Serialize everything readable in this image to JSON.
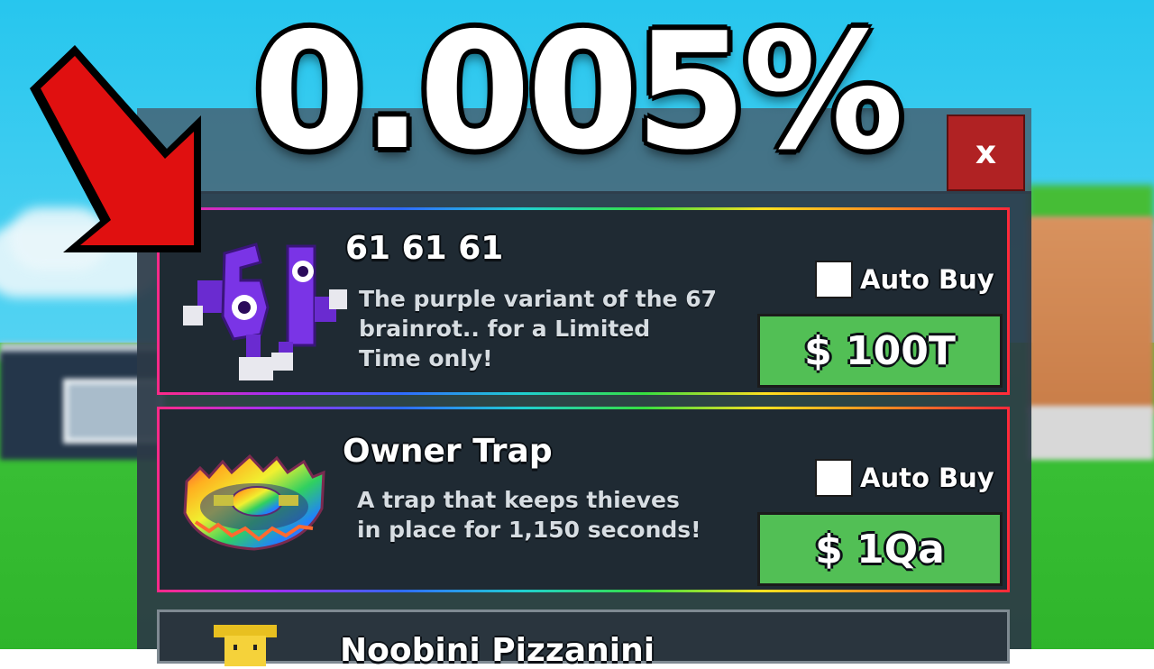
{
  "headline": "0.005%",
  "close_label": "x",
  "items": [
    {
      "name": "61 61 61",
      "description_lines": [
        "The purple variant of the 67",
        "brainrot.. for a Limited",
        "Time only!"
      ],
      "auto_buy_label": "Auto Buy",
      "price": "$ 100T",
      "icon": "purple-61-character-icon"
    },
    {
      "name": "Owner Trap",
      "description_lines": [
        "A trap that keeps thieves",
        "in place for 1,150 seconds!"
      ],
      "auto_buy_label": "Auto Buy",
      "price": "$ 1Qa",
      "icon": "rainbow-bear-trap-icon"
    },
    {
      "name": "Noobini Pizzanini",
      "icon": "yellow-noob-icon"
    }
  ],
  "colors": {
    "price_button": "#52bf55",
    "close_button": "#b02223",
    "arrow": "#e01010"
  }
}
